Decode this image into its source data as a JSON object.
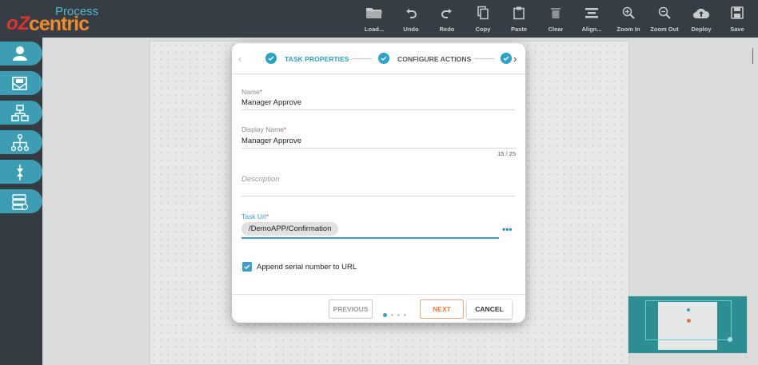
{
  "logo": {
    "process": "Process",
    "oz": "oZ",
    "centric": "centric"
  },
  "toolbar": [
    {
      "label": "Load...",
      "icon": "folder-icon"
    },
    {
      "label": "Undo",
      "icon": "undo-icon"
    },
    {
      "label": "Redo",
      "icon": "redo-icon"
    },
    {
      "label": "Copy",
      "icon": "copy-icon"
    },
    {
      "label": "Paste",
      "icon": "paste-icon"
    },
    {
      "label": "Clear",
      "icon": "trash-icon"
    },
    {
      "label": "Align...",
      "icon": "align-icon"
    },
    {
      "label": "Zoom In",
      "icon": "zoom-in-icon"
    },
    {
      "label": "Zoom Out",
      "icon": "zoom-out-icon"
    },
    {
      "label": "Deploy",
      "icon": "cloud-upload-icon"
    },
    {
      "label": "Save",
      "icon": "save-icon"
    }
  ],
  "rail": [
    "user-icon",
    "mail-task-icon",
    "hierarchy-icon",
    "tree-icon",
    "connector-icon",
    "database-icon"
  ],
  "modal": {
    "steps": [
      {
        "label": "TASK PROPERTIES",
        "active": true
      },
      {
        "label": "CONFIGURE ACTIONS",
        "active": false
      }
    ],
    "fields": {
      "name_label": "Name",
      "name_value": "Manager Approve",
      "display_label": "Display Name",
      "display_value": "Manager Approve",
      "display_counter": "15 / 25",
      "description_placeholder": "Description",
      "task_url_label": "Task Url",
      "task_url_value": "/DemoAPP/Confirmation",
      "required_mark": "*",
      "more_button": "•••"
    },
    "append_serial": {
      "label": "Append serial number to URL",
      "checked": true
    },
    "footer": {
      "previous": "PREVIOUS",
      "next": "NEXT",
      "cancel": "CANCEL",
      "page_current": 1,
      "page_total": 4
    }
  },
  "colors": {
    "topbar": "#363d44",
    "rail": "#343b42",
    "rail_button": "#3d9db3",
    "accent": "#29a3c7",
    "next": "#f07c3d"
  }
}
